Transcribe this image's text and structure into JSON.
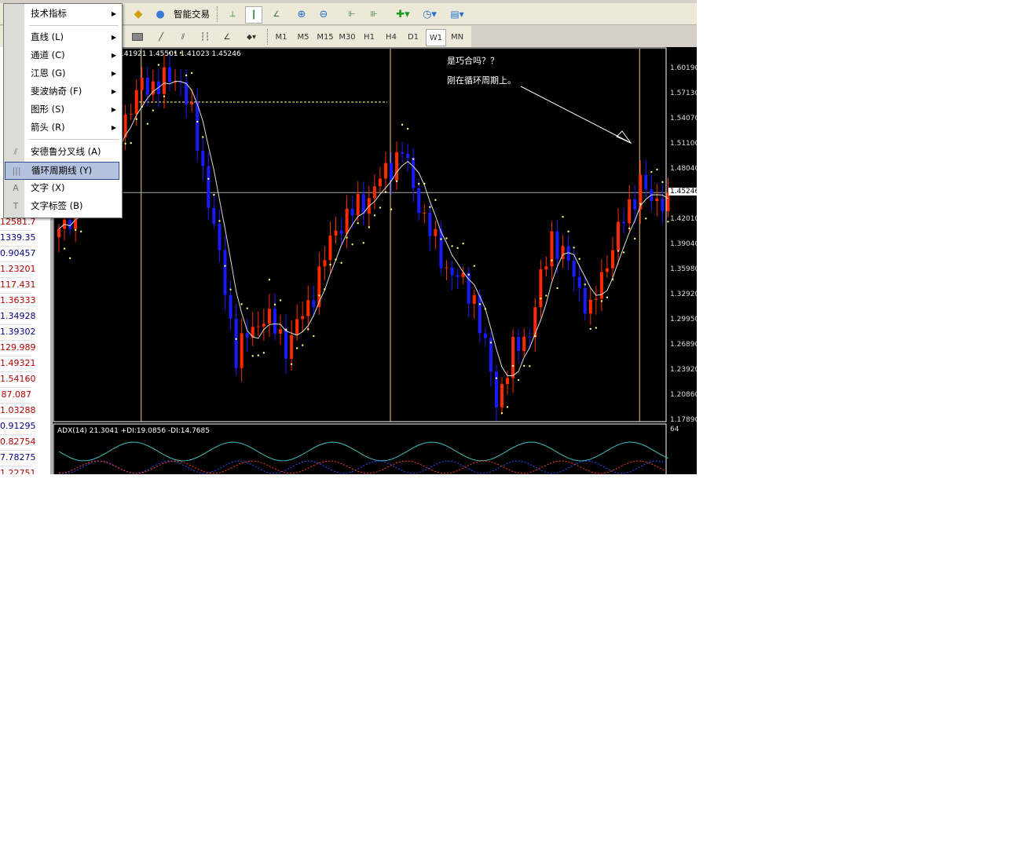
{
  "menu": {
    "items": [
      {
        "label": "技术指标",
        "submenu": true
      },
      {
        "label": "直线 (L)",
        "submenu": true
      },
      {
        "label": "通道 (C)",
        "submenu": true
      },
      {
        "label": "江恩 (G)",
        "submenu": true
      },
      {
        "label": "斐波纳奇 (F)",
        "submenu": true
      },
      {
        "label": "图形 (S)",
        "submenu": true
      },
      {
        "label": "箭头 (R)",
        "submenu": true
      },
      {
        "label": "安德鲁分叉线 (A)",
        "icon": "andrews-pitchfork-icon"
      },
      {
        "label": "循环周期线 (Y)",
        "icon": "cycle-lines-icon",
        "highlighted": true
      },
      {
        "label": "文字 (X)",
        "icon": "text-icon"
      },
      {
        "label": "文字标签 (B)",
        "icon": "text-label-icon"
      }
    ]
  },
  "toolbar": {
    "expert_label": "智能交易",
    "timeframes": [
      "M1",
      "M5",
      "M15",
      "M30",
      "H1",
      "H4",
      "D1",
      "W1",
      "MN"
    ],
    "active_timeframe": "W1"
  },
  "market_watch": {
    "values": [
      {
        "v": "12581.7",
        "c": "red"
      },
      {
        "v": "1339.35",
        "c": "blue"
      },
      {
        "v": "0.90457",
        "c": "blue"
      },
      {
        "v": "1.23201",
        "c": "red"
      },
      {
        "v": "117.431",
        "c": "red"
      },
      {
        "v": "1.36333",
        "c": "red"
      },
      {
        "v": "1.34928",
        "c": "blue"
      },
      {
        "v": "1.39302",
        "c": "blue"
      },
      {
        "v": "129.989",
        "c": "red"
      },
      {
        "v": "1.49321",
        "c": "red"
      },
      {
        "v": "1.54160",
        "c": "red"
      },
      {
        "v": "87.087",
        "c": "red"
      },
      {
        "v": "1.03288",
        "c": "red"
      },
      {
        "v": "0.91295",
        "c": "blue"
      },
      {
        "v": "0.82754",
        "c": "red"
      },
      {
        "v": "7.78275",
        "c": "blue"
      },
      {
        "v": "1.22751",
        "c": "red"
      }
    ]
  },
  "chart": {
    "ohlc": ".41921 1.45501 1.41023 1.45246",
    "note1": "是巧合吗？？",
    "note2": "刚在循环周期上。",
    "current_price": "1.45246",
    "axis_labels": [
      "1.60190",
      "1.57130",
      "1.54070",
      "1.51100",
      "1.48040",
      "1.42010",
      "1.39040",
      "1.35980",
      "1.32920",
      "1.29950",
      "1.26890",
      "1.23920",
      "1.20860",
      "1.17890"
    ],
    "adx_label": "ADX(14) 21.3041 +DI:19.0856 -DI:14.7685",
    "adx_max": "64",
    "colors": {
      "up": "#ff2a00",
      "down": "#1a1aff",
      "sar": "#ffff80",
      "cycle": "#e8c890"
    }
  },
  "chart_data": {
    "type": "candlestick",
    "ylim": [
      1.1789,
      1.6019
    ],
    "bars": 111,
    "path": [
      [
        0,
        1.4008
      ],
      [
        15,
        1.5802
      ],
      [
        22,
        1.5896
      ],
      [
        24,
        1.5424
      ],
      [
        27,
        1.448
      ],
      [
        32,
        1.2592
      ],
      [
        35,
        1.2876
      ],
      [
        37,
        1.3064
      ],
      [
        41,
        1.2687
      ],
      [
        45,
        1.3159
      ],
      [
        50,
        1.4103
      ],
      [
        56,
        1.448
      ],
      [
        62,
        1.5047
      ],
      [
        64,
        1.4575
      ],
      [
        69,
        1.3725
      ],
      [
        75,
        1.3253
      ],
      [
        79,
        1.2026
      ],
      [
        82,
        1.2592
      ],
      [
        85,
        1.2876
      ],
      [
        89,
        1.4008
      ],
      [
        93,
        1.3536
      ],
      [
        96,
        1.3064
      ],
      [
        99,
        1.3725
      ],
      [
        105,
        1.4669
      ],
      [
        107,
        1.4386
      ],
      [
        110,
        1.45246
      ]
    ],
    "cycle_bars": [
      15,
      60,
      105
    ],
    "last_price": 1.45246
  }
}
